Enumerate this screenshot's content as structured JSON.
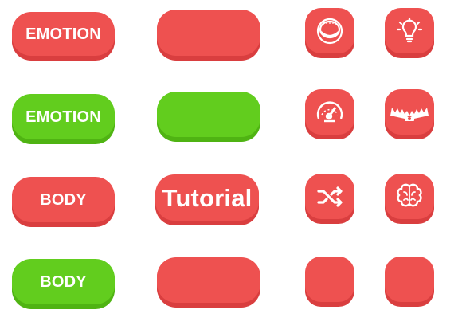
{
  "colors": {
    "red": "#ee5150",
    "red_shadow": "#d93e3f",
    "green": "#62cd1e",
    "green_shadow": "#4fb313",
    "text": "#ffffff"
  },
  "buttons": {
    "emotion_red": "EMOTION",
    "emotion_green": "EMOTION",
    "body_red": "BODY",
    "body_green": "BODY",
    "tutorial": "Tutorial",
    "blank_red_1": "",
    "blank_green": "",
    "blank_red_2": ""
  },
  "icons": {
    "row1": [
      "coin-icon",
      "lightbulb-icon"
    ],
    "row2": [
      "speedometer-icon",
      "bear-trap-icon"
    ],
    "row3": [
      "shuffle-icon",
      "brain-icon"
    ],
    "row4": [
      "blank",
      "blank"
    ]
  }
}
